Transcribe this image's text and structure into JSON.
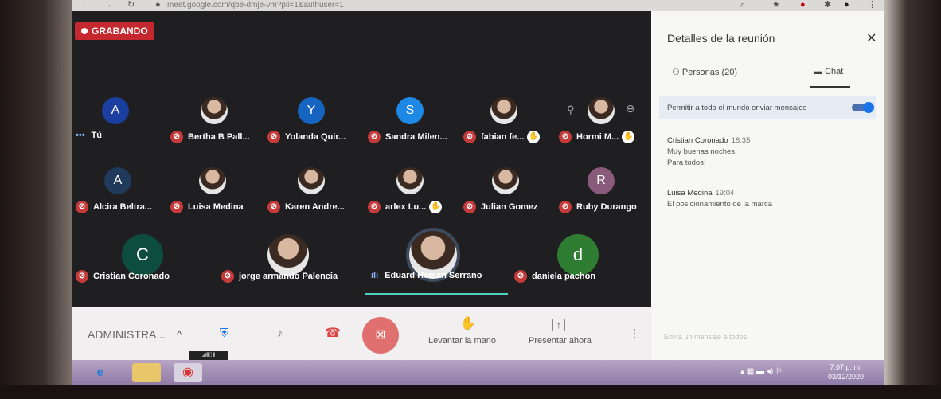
{
  "browser": {
    "url": "meet.google.com/qbe-dmje-vm?pli=1&authuser=1"
  },
  "meeting": {
    "recording_label": "GRABANDO",
    "participants_row1": [
      {
        "initial": "A",
        "name": "Tú",
        "color": "#1a3fa0",
        "self": true
      },
      {
        "initial": "",
        "name": "Bertha B Pall...",
        "photo": true
      },
      {
        "initial": "Y",
        "name": "Yolanda Quir...",
        "color": "#1565c0"
      },
      {
        "initial": "S",
        "name": "Sandra Milen...",
        "color": "#1e88e5"
      },
      {
        "initial": "",
        "name": "fabian fe...",
        "photo": true,
        "hand": true
      },
      {
        "initial": "",
        "name": "Hormi M...",
        "photo": true,
        "hand": true
      }
    ],
    "participants_row2": [
      {
        "initial": "A",
        "name": "Alcira Beltra...",
        "color": "#1f3a5a"
      },
      {
        "initial": "",
        "name": "Luisa Medina",
        "photo": true
      },
      {
        "initial": "",
        "name": "Karen Andre...",
        "photo": true
      },
      {
        "initial": "",
        "name": "arlex Lu...",
        "photo": true,
        "hand": true
      },
      {
        "initial": "",
        "name": "Julian Gomez",
        "photo": true
      },
      {
        "initial": "R",
        "name": "Ruby Durango",
        "color": "#8a5a7a"
      }
    ],
    "participants_row3": [
      {
        "initial": "C",
        "name": "Cristian Coronado",
        "color": "#0d4d40"
      },
      {
        "initial": "",
        "name": "jorge armando Palencia",
        "photo": true
      },
      {
        "initial": "",
        "name": "Eduard Heman Serrano",
        "photo": true,
        "speaking": true
      },
      {
        "initial": "d",
        "name": "daniela pachon",
        "color": "#2e7d32"
      }
    ]
  },
  "toolbar": {
    "admin_label": "ADMINISTRA...",
    "raise_hand": "Levantar la mano",
    "present": "Presentar ahora"
  },
  "panel": {
    "title": "Detalles de la reunión",
    "people_tab": "Personas (20)",
    "chat_tab": "Chat",
    "permission": "Permitir a todo el mundo enviar mensajes",
    "messages": [
      {
        "author": "Cristian Coronado",
        "time": "18:35",
        "lines": [
          "Muy buenas noches.",
          "Para todos!"
        ]
      },
      {
        "author": "Luisa Medina",
        "time": "19:04",
        "lines": [
          "El posicionamiento de la marca"
        ]
      }
    ],
    "send_placeholder": "Envía un mensaje a todos"
  },
  "taskbar": {
    "time": "7:07 p. m.",
    "date": "03/12/2020"
  },
  "colors": {
    "mute": "#c53b3b",
    "record": "#c5282e",
    "accent": "#1a73e8",
    "end_call": "#e07070"
  }
}
